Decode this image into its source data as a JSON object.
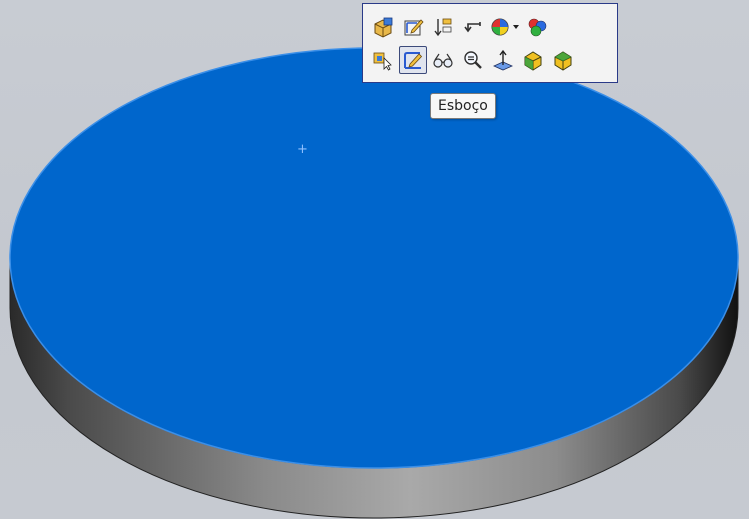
{
  "toolbar": {
    "rows": [
      [
        {
          "name": "edit-feature-icon"
        },
        {
          "name": "edit-sketch-icon"
        },
        {
          "name": "rollback-icon"
        },
        {
          "name": "parent-child-icon"
        },
        {
          "name": "appearance-icon"
        },
        {
          "name": "appearance-dropdown-arrow-icon"
        },
        {
          "name": "color-balls-icon"
        }
      ],
      [
        {
          "name": "select-other-icon"
        },
        {
          "name": "sketch-icon",
          "active": true
        },
        {
          "name": "view-glasses-icon"
        },
        {
          "name": "zoom-to-selection-icon"
        },
        {
          "name": "normal-to-icon"
        },
        {
          "name": "face-view-icon"
        },
        {
          "name": "face-view-alt-icon"
        }
      ]
    ]
  },
  "tooltip": {
    "text": "Esboço"
  },
  "model": {
    "top_face_color": "#0066cc",
    "top_face_edge_color": "#3b8fe8",
    "side_dark_color": "#1a1a1a",
    "side_light_color": "#a8a8a8",
    "origin_marker": "+"
  }
}
